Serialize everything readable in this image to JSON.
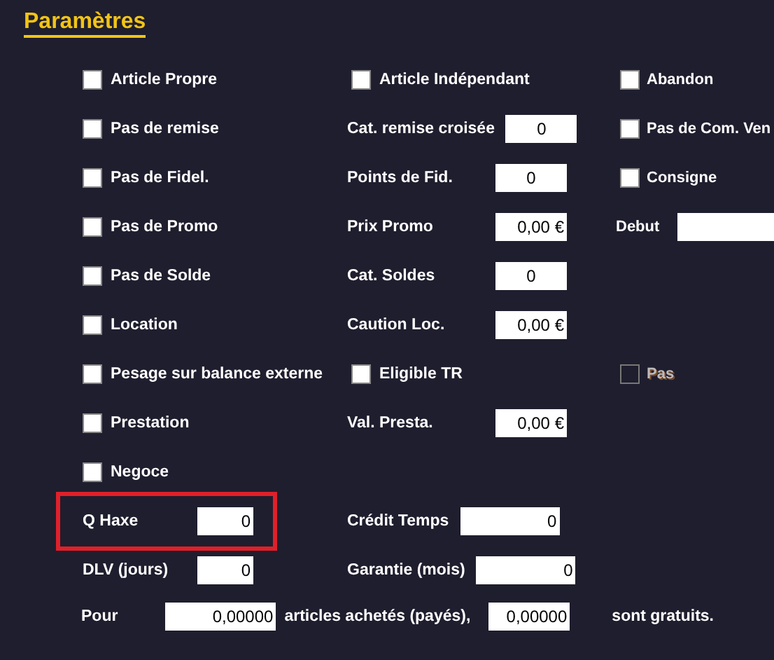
{
  "title": "Paramètres",
  "rows": [
    {
      "cells": [
        {
          "kind": "checkbox",
          "label": "Article Propre",
          "checked": false,
          "disabled": false
        },
        {
          "kind": "checkbox",
          "label": "Article Indépendant",
          "checked": false,
          "disabled": false
        },
        {
          "kind": "checkbox",
          "label": "Abandon",
          "checked": false,
          "disabled": false
        }
      ]
    },
    {
      "cells": [
        {
          "kind": "checkbox",
          "label": "Pas de remise",
          "checked": false,
          "disabled": false
        },
        {
          "kind": "field",
          "label": "Cat. remise croisée",
          "value": "0"
        },
        {
          "kind": "checkbox",
          "label": "Pas de Com. Ven",
          "checked": false,
          "disabled": false
        }
      ]
    },
    {
      "cells": [
        {
          "kind": "checkbox",
          "label": "Pas de Fidel.",
          "checked": false,
          "disabled": false
        },
        {
          "kind": "field",
          "label": "Points de Fid.",
          "value": "0"
        },
        {
          "kind": "checkbox",
          "label": "Consigne",
          "checked": false,
          "disabled": false
        }
      ]
    },
    {
      "cells": [
        {
          "kind": "checkbox",
          "label": "Pas de Promo",
          "checked": false,
          "disabled": false
        },
        {
          "kind": "money-field",
          "label": "Prix Promo",
          "value": "0,00 €"
        },
        {
          "kind": "wide-field",
          "label": "Debut"
        }
      ]
    },
    {
      "cells": [
        {
          "kind": "checkbox",
          "label": "Pas de Solde",
          "checked": false,
          "disabled": false
        },
        {
          "kind": "field",
          "label": "Cat. Soldes",
          "value": "0"
        },
        {
          "kind": "empty"
        }
      ]
    },
    {
      "cells": [
        {
          "kind": "checkbox",
          "label": "Location",
          "checked": false,
          "disabled": false
        },
        {
          "kind": "money-field",
          "label": "Caution Loc.",
          "value": "0,00 €"
        },
        {
          "kind": "empty"
        }
      ]
    },
    {
      "cells": [
        {
          "kind": "checkbox",
          "label": "Pesage sur balance externe",
          "checked": false,
          "disabled": false
        },
        {
          "kind": "checkbox",
          "label": "Eligible TR",
          "checked": false,
          "disabled": false
        },
        {
          "kind": "checkbox",
          "label": "Pas",
          "checked": false,
          "disabled": true
        }
      ]
    },
    {
      "cells": [
        {
          "kind": "checkbox",
          "label": "Prestation",
          "checked": false,
          "disabled": false
        },
        {
          "kind": "money-field",
          "label": "Val. Presta.",
          "value": "0,00 €"
        },
        {
          "kind": "empty"
        }
      ]
    },
    {
      "cells": [
        {
          "kind": "checkbox",
          "label": "Negoce",
          "checked": false,
          "disabled": false
        },
        {
          "kind": "empty"
        },
        {
          "kind": "empty"
        }
      ]
    },
    {
      "cells": [
        {
          "kind": "short-field",
          "label": "Q Haxe",
          "value": "0",
          "highlighted": true
        },
        {
          "kind": "long-field",
          "label": "Crédit Temps",
          "value": "0"
        },
        {
          "kind": "empty"
        }
      ]
    },
    {
      "cells": [
        {
          "kind": "short-field",
          "label": "DLV (jours)",
          "value": "0",
          "highlighted": false
        },
        {
          "kind": "long-field",
          "label": "Garantie (mois)",
          "value": "0"
        },
        {
          "kind": "empty"
        }
      ]
    }
  ],
  "offer": {
    "prefix": "Pour",
    "bought": "0,00000",
    "middle": "articles achetés (payés),",
    "free": "0,00000",
    "suffix": "sont gratuits."
  }
}
